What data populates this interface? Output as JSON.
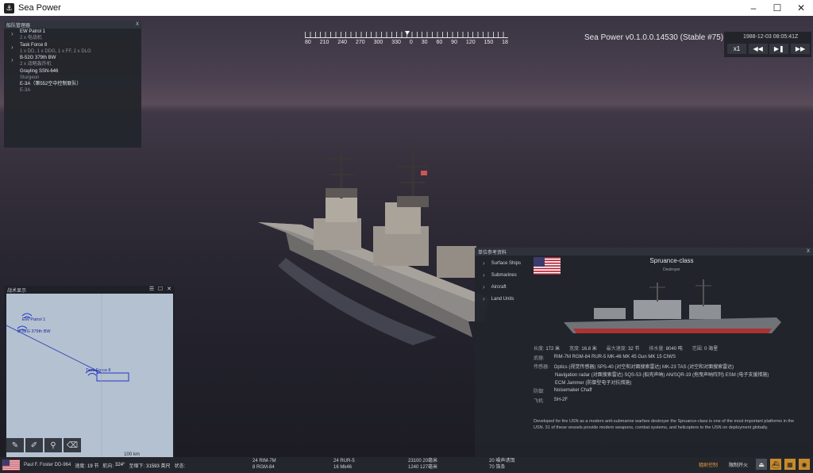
{
  "window": {
    "title": "Sea Power",
    "minimize": "–",
    "maximize": "☐",
    "close": "✕"
  },
  "hud": {
    "version": "Sea Power v0.1.0.0.14530 (Stable #75)",
    "clock": "1988-12-03 08:05:41Z",
    "time_scale": "x1",
    "compass_labels": [
      "80",
      "210",
      "240",
      "270",
      "300",
      "330",
      "0",
      "30",
      "60",
      "90",
      "120",
      "150",
      "18"
    ]
  },
  "fleet": {
    "title": "船队管理器",
    "close": "X",
    "items": [
      {
        "name": "EW Patrol 1",
        "sub": "2 x 电战机"
      },
      {
        "name": "Task Force 8",
        "sub": "1 x DD, 1 x DDG, 1 x FF, 2 x DLG"
      },
      {
        "name": "B-52G 379th BW",
        "sub": "2 x 战略轰炸机"
      },
      {
        "name": "Grayling SSN-646",
        "sub": "Sturgeon"
      },
      {
        "name": "E-3A（第552空中控制联队）",
        "sub": "E-3A"
      }
    ]
  },
  "minimap": {
    "title": "战术显示",
    "scale": "100 km",
    "labels": {
      "ew": "EW Patrol 1",
      "b52": "B-52G 379th BW",
      "tf": "Task Force 8"
    }
  },
  "reference": {
    "title": "单位参考资料",
    "close": "X",
    "categories": [
      "Surface Ships",
      "Submarines",
      "Aircraft",
      "Land Units"
    ],
    "ship_name": "Spruance-class",
    "ship_type": "Destroyer",
    "stats": {
      "length_label": "长度:",
      "length": "172 米",
      "beam_label": "宽度:",
      "beam": "16.8 米",
      "speed_label": "最大速度:",
      "speed": "32 节",
      "displacement_label": "排水量:",
      "displacement": "8040 吨",
      "range_label": "范围:",
      "range": "0 海里"
    },
    "weapons_label": "武器:",
    "weapons": "RIM-7M  RGM-84  RUR-5  MK-46  MK 45 Gun  MK 15 CIWS",
    "sensors_label": "传感器:",
    "sensors": [
      "Optics (视觉传感器)  SPS-40 (对空和对面搜索雷达)  MK-23 TAS (对空和对面搜索雷达)",
      "Navigation radar (对面搜索雷达)  SQS-53 (船壳声呐)  AN/SQR-19 (拖曳声呐阵列)  ESM (电子支援措施)",
      "ECM Jammer (防御型电子对抗措施)"
    ],
    "defense_label": "防御:",
    "defense": "Noisemaker  Chaff",
    "aircraft_label": "飞机:",
    "aircraft": "SH-2F",
    "description": "Developed for the USN as a modern anti-submarine warfare destroyer the Spruance-class is one of the most important platforms in the USN. 31 of these vessels provide modern weapons, combat systems, and helicopters to the USN on deployment globally."
  },
  "bottom": {
    "unit": "Paul F. Foster DD-964",
    "speed_label": "速度:",
    "speed": "19 节",
    "heading_label": "航向:",
    "heading": "324°",
    "depth_label": "至缩下:",
    "depth": "31593 英尺",
    "status_label": "状态:",
    "ammo": [
      {
        "a": "24 RIM-7M",
        "b": "8 RGM-84"
      },
      {
        "a": "24 RUR-5",
        "b": "16 Mk46"
      },
      {
        "a": "23100 20毫米",
        "b": "1240 127毫米"
      },
      {
        "a": "20 噪声诱饵",
        "b": "70 箔条"
      }
    ],
    "link1": "辐射控制",
    "link2": "限制开火"
  }
}
